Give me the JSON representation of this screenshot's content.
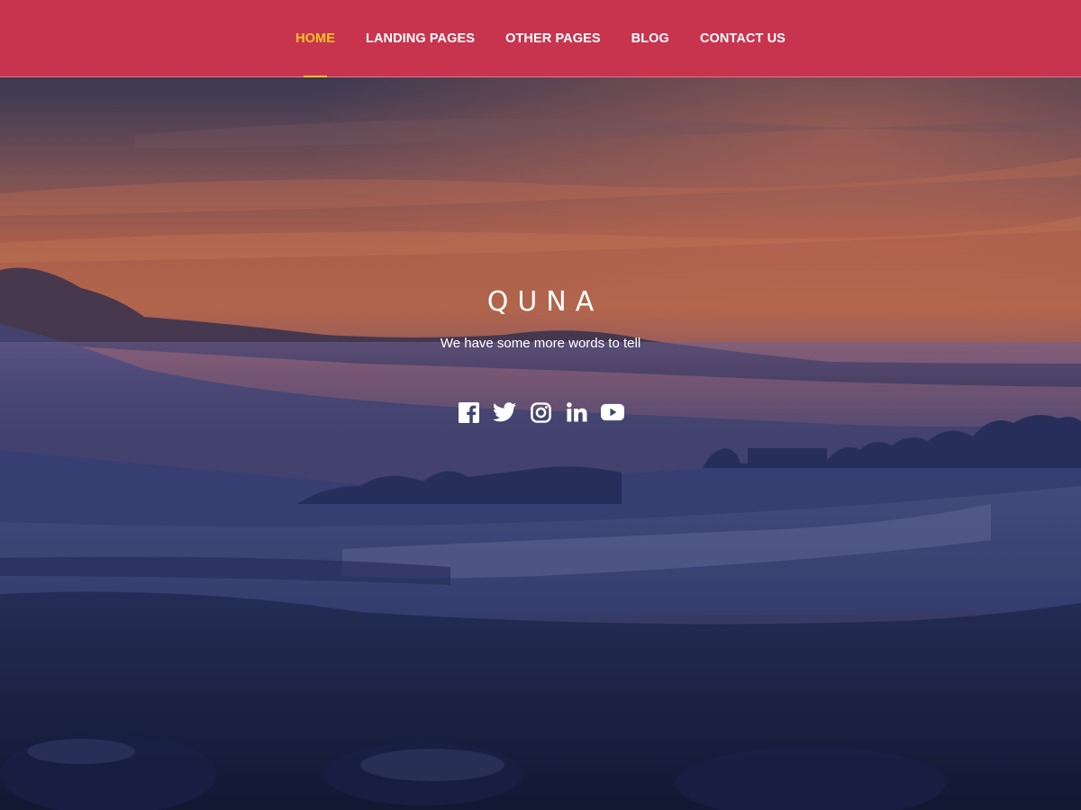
{
  "nav": {
    "items": [
      {
        "label": "HOME",
        "active": true
      },
      {
        "label": "LANDING PAGES",
        "active": false
      },
      {
        "label": "OTHER PAGES",
        "active": false
      },
      {
        "label": "BLOG",
        "active": false
      },
      {
        "label": "CONTACT US",
        "active": false
      }
    ]
  },
  "hero": {
    "title": "QUNA",
    "tagline": "We have some more words to tell",
    "social_icons": [
      "facebook-icon",
      "twitter-icon",
      "instagram-icon",
      "linkedin-icon",
      "youtube-icon"
    ]
  },
  "colors": {
    "nav_background": "#c8344e",
    "nav_active": "#f4c22b",
    "text": "#ffffff"
  }
}
